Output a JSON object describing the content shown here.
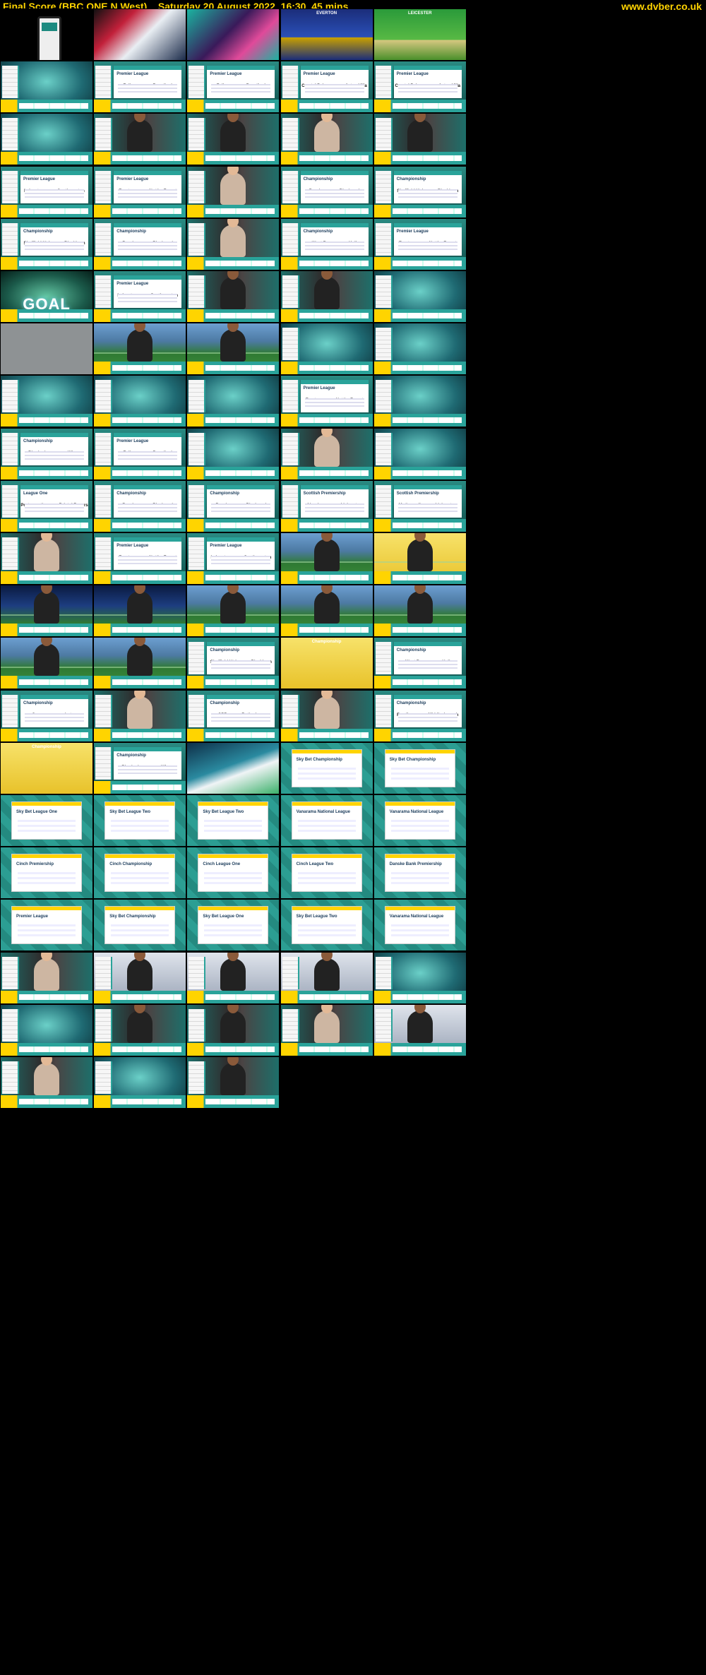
{
  "header": {
    "title": "Final Score (BBC ONE N West)    Saturday 20 August 2022  16:30  45 mins",
    "site": "www.dvber.co.uk"
  },
  "cells": [
    {
      "t": "phone",
      "label": ""
    },
    {
      "t": "promo",
      "label": ""
    },
    {
      "t": "pink",
      "label": ""
    },
    {
      "t": "everton",
      "label": "EVERTON",
      "caption": "EVERTON"
    },
    {
      "t": "leicester",
      "label": "LEICESTER",
      "caption": "LEICESTER"
    },
    {
      "t": "studio",
      "label": ""
    },
    {
      "t": "score",
      "label": "Fulham 1-1 Brentford",
      "head": "Premier League",
      "home": "Fulham",
      "away": "Brentford",
      "hs": "1",
      "as": "1"
    },
    {
      "t": "score",
      "label": "Fulham 1-1 Brentford",
      "head": "Premier League",
      "home": "Fulham",
      "away": "Brentford",
      "hs": "1",
      "as": "1"
    },
    {
      "t": "score",
      "label": "Crystal Palace 1-1 Aston Villa",
      "head": "Premier League",
      "home": "Crystal Palace",
      "away": "Aston Villa",
      "hs": "1",
      "as": "1"
    },
    {
      "t": "score",
      "label": "Crystal Palace 1-1 Aston Villa",
      "head": "Premier League",
      "home": "Crystal Palace",
      "away": "Aston Villa",
      "hs": "1",
      "as": "1"
    },
    {
      "t": "studio",
      "label": ""
    },
    {
      "t": "pres",
      "label": ""
    },
    {
      "t": "pres",
      "label": ""
    },
    {
      "t": "presl",
      "label": ""
    },
    {
      "t": "pres",
      "label": ""
    },
    {
      "t": "score",
      "label": "Leicester 1-1 Southampton",
      "head": "Premier League",
      "home": "Leicester",
      "away": "Southampton",
      "hs": "1",
      "as": "1"
    },
    {
      "t": "score",
      "label": "Everton 1-1 Nott'm Forest",
      "head": "Premier League",
      "home": "Everton",
      "away": "Nott'm Forest",
      "hs": "1",
      "as": "1"
    },
    {
      "t": "presl",
      "label": ""
    },
    {
      "t": "score",
      "label": "Burnley 1-1 Blackpool",
      "head": "Championship",
      "home": "Burnley",
      "away": "Blackpool",
      "hs": "1",
      "as": "1"
    },
    {
      "t": "score",
      "label": "Sheffield Utd 1-0 Blackburn",
      "head": "Championship",
      "home": "Sheffield Utd",
      "away": "Blackburn",
      "hs": "1",
      "as": "0"
    },
    {
      "t": "score",
      "label": "Sheffield Utd 1-0 Blackburn",
      "head": "Championship",
      "home": "Sheffield Utd",
      "away": "Blackburn",
      "hs": "1",
      "as": "0"
    },
    {
      "t": "score",
      "label": "Burnley 1-1 Blackpool",
      "head": "Championship",
      "home": "Burnley",
      "away": "Blackpool",
      "hs": "1",
      "as": "1"
    },
    {
      "t": "presl",
      "label": ""
    },
    {
      "t": "score",
      "label": "West Brom 1-1 Hull",
      "head": "Championship",
      "home": "West Brom",
      "away": "Hull",
      "hs": "1",
      "as": "1"
    },
    {
      "t": "score",
      "label": "Everton 1-1 Nott'm Forest",
      "head": "Premier League",
      "home": "Everton",
      "away": "Nott'm Forest",
      "hs": "1",
      "as": "1"
    },
    {
      "t": "goal",
      "label": "GOAL",
      "caption": "GOAL"
    },
    {
      "t": "score",
      "label": "Leicester 1-2 Southampton",
      "head": "Premier League",
      "home": "Leicester",
      "away": "Southampton",
      "hs": "1",
      "as": "2"
    },
    {
      "t": "pres",
      "label": ""
    },
    {
      "t": "pres",
      "label": ""
    },
    {
      "t": "studio",
      "label": ""
    },
    {
      "t": "grey",
      "label": ""
    },
    {
      "t": "pitch",
      "label": ""
    },
    {
      "t": "pitch",
      "label": ""
    },
    {
      "t": "studio",
      "label": ""
    },
    {
      "t": "studio",
      "label": ""
    },
    {
      "t": "studio",
      "label": ""
    },
    {
      "t": "studio",
      "label": ""
    },
    {
      "t": "studio",
      "label": ""
    },
    {
      "t": "score",
      "label": "Everton 1-1 Nott'm Forest",
      "head": "Premier League",
      "home": "Everton",
      "away": "Nott'm Forest",
      "hs": "1",
      "as": "1"
    },
    {
      "t": "studio",
      "label": ""
    },
    {
      "t": "score",
      "label": "Birmingham 1-1 Wigan",
      "head": "Championship",
      "home": "Birmingham",
      "away": "Wigan",
      "hs": "1",
      "as": "1"
    },
    {
      "t": "score",
      "label": "Fulham 2-2 Brentford",
      "head": "Premier League",
      "home": "Fulham",
      "away": "Brentford",
      "hs": "2",
      "as": "2"
    },
    {
      "t": "studio",
      "label": ""
    },
    {
      "t": "presl",
      "label": ""
    },
    {
      "t": "studio",
      "label": ""
    },
    {
      "t": "score",
      "label": "Portsmouth 2-2 Bristol Rovers",
      "head": "League One",
      "home": "Portsmouth",
      "away": "Bristol Rovers",
      "hs": "2",
      "as": "2"
    },
    {
      "t": "score",
      "label": "Burnley 1-1 Blackpool",
      "head": "Championship",
      "home": "Burnley",
      "away": "Blackpool",
      "hs": "1",
      "as": "1"
    },
    {
      "t": "score",
      "label": "Burnley 1-1 Blackpool",
      "head": "Championship",
      "home": "Burnley",
      "away": "Blackpool",
      "hs": "1",
      "as": "1"
    },
    {
      "t": "score",
      "label": "Aberdeen 0-0 Livingston",
      "head": "Scottish Premiership",
      "home": "Aberdeen",
      "away": "Livingston",
      "hs": "0",
      "as": "0"
    },
    {
      "t": "score",
      "label": "Motherwell 0-0 Livingston",
      "head": "Scottish Premiership",
      "home": "Motherwell",
      "away": "Livingston",
      "hs": "0",
      "as": "0"
    },
    {
      "t": "presl",
      "label": ""
    },
    {
      "t": "score",
      "label": "Everton 1-1 Nott'm Forest",
      "head": "Premier League",
      "home": "Everton",
      "away": "Nott'm Forest",
      "hs": "1",
      "as": "1"
    },
    {
      "t": "score",
      "label": "Leicester 1-2 Southampton",
      "head": "Premier League",
      "home": "Leicester",
      "away": "Southampton",
      "hs": "1",
      "as": "2"
    },
    {
      "t": "pitch",
      "label": ""
    },
    {
      "t": "yellowpitch",
      "label": ""
    },
    {
      "t": "crowd",
      "label": ""
    },
    {
      "t": "crowd",
      "label": ""
    },
    {
      "t": "pitch",
      "label": ""
    },
    {
      "t": "pitch",
      "label": ""
    },
    {
      "t": "pitch",
      "label": ""
    },
    {
      "t": "pitch",
      "label": ""
    },
    {
      "t": "pitch",
      "label": ""
    },
    {
      "t": "score",
      "label": "Sheffield Utd 1-0 Blackburn",
      "head": "Championship",
      "home": "Sheffield Utd",
      "away": "Blackburn",
      "hs": "1",
      "as": "0"
    },
    {
      "t": "yellow",
      "label": "Championship",
      "caption": "Championship"
    },
    {
      "t": "score",
      "label": "West Brom 1-1 Hull",
      "head": "Championship",
      "home": "West Brom",
      "away": "Hull",
      "hs": "1",
      "as": "1"
    },
    {
      "t": "score",
      "label": "Swansea 0-2 Luton",
      "head": "Championship",
      "home": "Swansea",
      "away": "Luton",
      "hs": "0",
      "as": "2"
    },
    {
      "t": "presl",
      "label": ""
    },
    {
      "t": "score",
      "label": "QPR 1-1 Rotherham",
      "head": "Championship",
      "home": "QPR",
      "away": "Rotherham",
      "hs": "1",
      "as": "1"
    },
    {
      "t": "presl",
      "label": ""
    },
    {
      "t": "score",
      "label": "Reading 1-0 Middlesbrough",
      "head": "Championship",
      "home": "Reading",
      "away": "Middlesbrough",
      "hs": "1",
      "as": "0"
    },
    {
      "t": "yellow",
      "label": "Championship",
      "caption": "Championship"
    },
    {
      "t": "score",
      "label": "Birmingham 1-1 Wigan",
      "head": "Championship",
      "home": "Birmingham",
      "away": "Wigan",
      "hs": "1",
      "as": "1"
    },
    {
      "t": "abstract",
      "label": ""
    },
    {
      "t": "table",
      "label": "Sky Bet Championship",
      "head": "Sky Bet Championship"
    },
    {
      "t": "table",
      "label": "Sky Bet Championship",
      "head": "Sky Bet Championship"
    },
    {
      "t": "table",
      "label": "Sky Bet League One",
      "head": "Sky Bet League One"
    },
    {
      "t": "table",
      "label": "Sky Bet League Two",
      "head": "Sky Bet League Two"
    },
    {
      "t": "table",
      "label": "Sky Bet League Two",
      "head": "Sky Bet League Two"
    },
    {
      "t": "table",
      "label": "Vanarama National League",
      "head": "Vanarama National League"
    },
    {
      "t": "table",
      "label": "Vanarama National League",
      "head": "Vanarama National League"
    },
    {
      "t": "table",
      "label": "Cinch Premiership",
      "head": "Cinch Premiership"
    },
    {
      "t": "table",
      "label": "Cinch Championship",
      "head": "Cinch Championship"
    },
    {
      "t": "table",
      "label": "Cinch League One",
      "head": "Cinch League One"
    },
    {
      "t": "table",
      "label": "Cinch League Two",
      "head": "Cinch League Two"
    },
    {
      "t": "table",
      "label": "Danske Bank Premiership",
      "head": "Danske Bank Premiership"
    },
    {
      "t": "table",
      "label": "Premier League",
      "head": "Premier League"
    },
    {
      "t": "table",
      "label": "Sky Bet Championship",
      "head": "Sky Bet Championship"
    },
    {
      "t": "table",
      "label": "Sky Bet League One",
      "head": "Sky Bet League One"
    },
    {
      "t": "table",
      "label": "Sky Bet League Two",
      "head": "Sky Bet League Two"
    },
    {
      "t": "table",
      "label": "Vanarama National League",
      "head": "Vanarama National League"
    },
    {
      "t": "presl",
      "label": ""
    },
    {
      "t": "interv",
      "label": ""
    },
    {
      "t": "interv",
      "label": ""
    },
    {
      "t": "interv",
      "label": ""
    },
    {
      "t": "studio",
      "label": ""
    },
    {
      "t": "studio",
      "label": ""
    },
    {
      "t": "pres",
      "label": ""
    },
    {
      "t": "pres",
      "label": ""
    },
    {
      "t": "presl",
      "label": ""
    },
    {
      "t": "interv",
      "label": ""
    },
    {
      "t": "presl",
      "label": ""
    },
    {
      "t": "studio",
      "label": ""
    },
    {
      "t": "pres",
      "label": ""
    }
  ]
}
